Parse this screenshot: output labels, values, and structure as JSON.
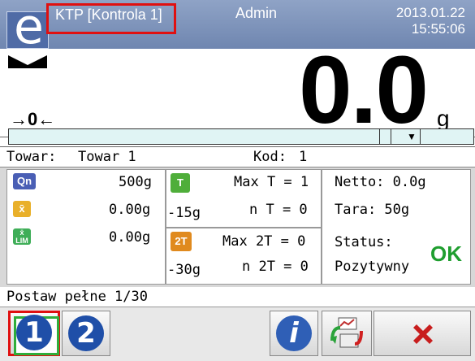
{
  "header": {
    "logo_glyph": "e",
    "title": "KTP [Kontrola 1]",
    "user": "Admin",
    "date": "2013.01.22",
    "time": "15:55:06"
  },
  "display": {
    "zero_indicator": "→0←",
    "reading": "0.0",
    "unit": "g"
  },
  "product": {
    "label_towar": "Towar:",
    "towar_value": "Towar 1",
    "label_kod": "Kod:",
    "kod_value": "1"
  },
  "stats": {
    "qn_icon": "Qn",
    "qn_value": "500g",
    "x_icon": "x̄",
    "x_value": "0.00g",
    "xlim_icon": "x̄ LIM",
    "xlim_value": "0.00g"
  },
  "thresholds": {
    "t_icon": "T",
    "t_value": "-15g",
    "max_t": "Max T = 1",
    "n_t": "n T = 0",
    "t2_icon": "2T",
    "t2_value": "-30g",
    "max_2t": "Max 2T = 0",
    "n_2t": "n 2T = 0"
  },
  "summary": {
    "netto": "Netto: 0.0g",
    "tara": "Tara: 50g",
    "status_label": "Status:",
    "status_value": "Pozytywny",
    "status_ok": "OK"
  },
  "statusbar": {
    "message": "Postaw pełne 1/30"
  },
  "buttons": {
    "btn1": "1",
    "btn2": "2",
    "info": "i"
  },
  "colors": {
    "accent": "#6f86b0",
    "highlight": "#e01010",
    "ok_green": "#1f9e2f"
  }
}
